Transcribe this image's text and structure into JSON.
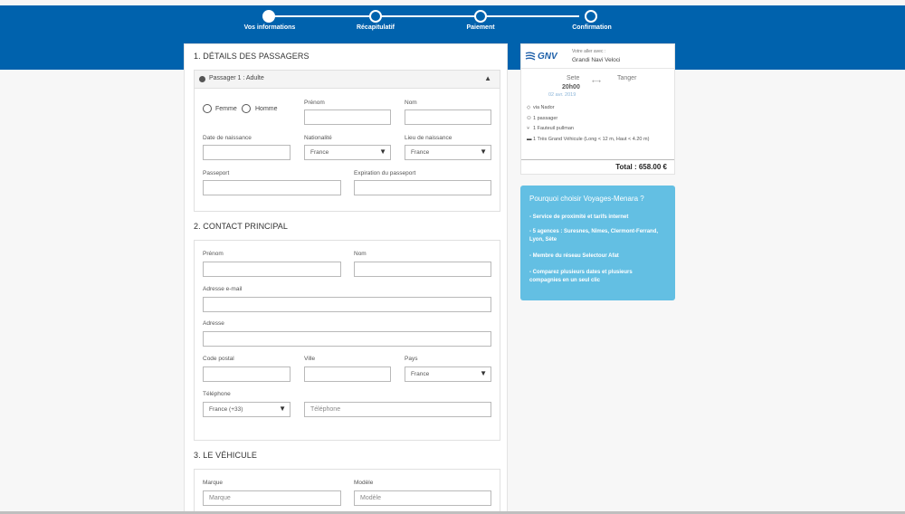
{
  "steps": [
    {
      "label": "Vos informations",
      "active": true
    },
    {
      "label": "Récapitulatif",
      "active": false
    },
    {
      "label": "Paiement",
      "active": false
    },
    {
      "label": "Confirmation",
      "active": false
    }
  ],
  "passengers": {
    "title": "1. DÉTAILS DES PASSAGERS",
    "accordion_label": "Passager 1 : Adulte",
    "gender_female": "Femme",
    "gender_male": "Homme",
    "firstname_label": "Prénom",
    "lastname_label": "Nom",
    "birthdate_label": "Date de naissance",
    "nationality_label": "Nationalité",
    "nationality_value": "France",
    "birthplace_label": "Lieu de naissance",
    "birthplace_value": "France",
    "passport_label": "Passeport",
    "passport_expiry_label": "Expiration du passeport"
  },
  "contact": {
    "title": "2. CONTACT PRINCIPAL",
    "firstname_label": "Prénom",
    "lastname_label": "Nom",
    "email_label": "Adresse e-mail",
    "address_label": "Adresse",
    "postal_label": "Code postal",
    "city_label": "Ville",
    "country_label": "Pays",
    "country_value": "France",
    "phone_label": "Téléphone",
    "phone_prefix": "France (+33)",
    "phone_placeholder": "Téléphone"
  },
  "vehicle": {
    "title": "3. LE VÉHICULE",
    "brand_label": "Marque",
    "brand_placeholder": "Marque",
    "model_label": "Modèle",
    "model_placeholder": "Modèle"
  },
  "summary": {
    "logo": "GNV",
    "outbound_label": "Votre aller avec :",
    "company": "Grandi Navi Veloci",
    "from": "Sete",
    "to": "Tanger",
    "arrow": "⟷",
    "time": "20h00",
    "date": "02 avr. 2019",
    "via": "via Nador",
    "passengers": "1 passager",
    "seat": "1 Fauteuil pullman",
    "vehicle": "1 Très Grand Véhicule (Long < 12 m, Haut < 4.20 m)",
    "total": "Total : 658.00 €"
  },
  "why": {
    "title": "Pourquoi choisir Voyages-Menara ?",
    "items": [
      "- Service de proximité et tarifs internet",
      "- 5 agences : Suresnes, Nîmes, Clermont-Ferrand, Lyon, Sète",
      "- Membre du réseau Selectour Afat",
      "- Comparez plusieurs dates et plusieurs compagnies en un seul clic"
    ]
  },
  "colors": {
    "brand_blue": "#0062ad",
    "info_blue": "#63bfe3"
  },
  "icons": {
    "accordion_toggle": "chevron-up-icon",
    "passenger": "user-circle-icon",
    "select_arrow": "triangle-down-icon"
  }
}
